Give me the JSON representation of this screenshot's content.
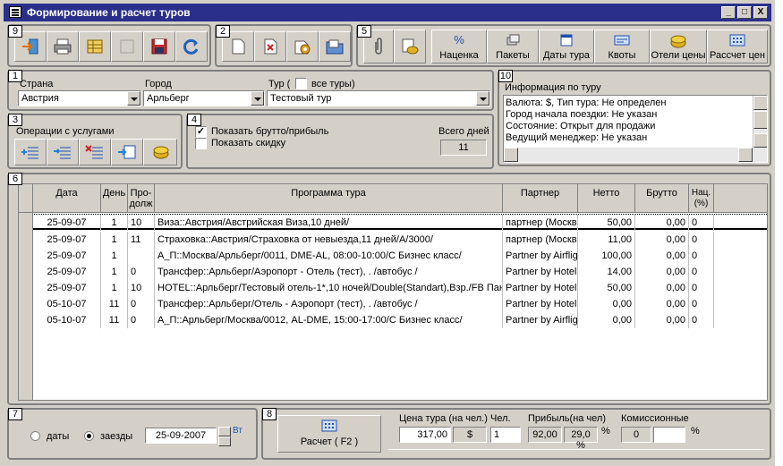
{
  "window": {
    "title": "Формирование и расчет туров",
    "min": "_",
    "max": "□",
    "close": "X"
  },
  "badges": [
    "9",
    "2",
    "5",
    "1",
    "10",
    "3",
    "4",
    "6",
    "7",
    "8"
  ],
  "toolbar5": {
    "markup": "Наценка",
    "packages": "Пакеты",
    "tour_dates": "Даты тура",
    "quotas": "Квоты",
    "hotel_prices": "Отели цены",
    "price_calc": "Рассчет цен",
    "percent_symbol": "%"
  },
  "filters": {
    "country_label": "Страна",
    "country_value": "Австрия",
    "city_label": "Город",
    "city_value": "Арльберг",
    "tour_label_prefix": "Тур (",
    "all_tours": "все туры)",
    "tour_value": "Тестовый тур"
  },
  "info": {
    "title": "Информация по туру",
    "lines": [
      "Валюта: $, Тип тура: Не определен",
      "Город начала поездки: Не указан",
      "Состояние: Открыт для продажи",
      "Ведущий менеджер: Не указан"
    ]
  },
  "services": {
    "title": "Операции с услугами"
  },
  "options": {
    "show_gross": "Показать брутто/прибыль",
    "show_gross_checked": "✓",
    "show_discount": "Показать скидку",
    "total_days_label": "Всего дней",
    "total_days": "11"
  },
  "grid": {
    "headers": {
      "date": "Дата",
      "day": "День",
      "duration": "Про-\nдолж",
      "program": "Программа тура",
      "partner": "Партнер",
      "net": "Нетто",
      "gross": "Брутто",
      "markup": "Нац. (%)"
    },
    "rows": [
      {
        "date": "25-09-07",
        "day": "1",
        "dur": "10",
        "program": "Виза::Австрия/Австрийская Виза,10 дней/",
        "partner": "партнер (Москва",
        "net": "50,00",
        "gross": "0,00",
        "markup": "0"
      },
      {
        "date": "25-09-07",
        "day": "1",
        "dur": "11",
        "program": "Страховка::Австрия/Страховка от невыезда,11 дней/А/3000/",
        "partner": "партнер (Москва",
        "net": "11,00",
        "gross": "0,00",
        "markup": "0"
      },
      {
        "date": "25-09-07",
        "day": "1",
        "dur": "",
        "program": "А_П::Москва/Арльберг/0011, DME-AL, 08:00-10:00/С Бизнес класс/",
        "partner": "Partner by Airflight",
        "net": "100,00",
        "gross": "0,00",
        "markup": "0"
      },
      {
        "date": "25-09-07",
        "day": "1",
        "dur": "0",
        "program": "Трансфер::Арльберг/Аэропорт - Отель (тест), . /автобус /",
        "partner": "Partner by Hotel",
        "net": "14,00",
        "gross": "0,00",
        "markup": "0"
      },
      {
        "date": "25-09-07",
        "day": "1",
        "dur": "10",
        "program": "HOTEL::Арльберг/Тестовый отель-1*,10 ночей/Double(Standart),Взр./FB Пан",
        "partner": "Partner by Hotel",
        "net": "50,00",
        "gross": "0,00",
        "markup": "0"
      },
      {
        "date": "05-10-07",
        "day": "11",
        "dur": "0",
        "program": "Трансфер::Арльберг/Отель - Аэропорт (тест), . /автобус /",
        "partner": "Partner by Hotel",
        "net": "0,00",
        "gross": "0,00",
        "markup": "0"
      },
      {
        "date": "05-10-07",
        "day": "11",
        "dur": "0",
        "program": "А_П::Арльберг/Москва/0012, AL-DME, 15:00-17:00/С Бизнес класс/",
        "partner": "Partner by Airflight",
        "net": "0,00",
        "gross": "0,00",
        "markup": "0"
      }
    ]
  },
  "dates": {
    "dates_label": "даты",
    "arrivals_label": "заезды",
    "date_value": "25-09-2007",
    "weekday": "Вт"
  },
  "calc": {
    "button": "Расчет ( F2 )",
    "price_label": "Цена тура (на чел.)",
    "price_value": "317,00",
    "currency": "$",
    "persons_label": "Чел.",
    "persons_value": "1",
    "profit_label": "Прибыль(на чел)",
    "profit_value": "92,00",
    "profit_pct": "29,0 %",
    "pct": "%",
    "commission_label": "Комиссионные",
    "commission_value": "0",
    "commission_pct": "",
    "pct2": "%"
  }
}
